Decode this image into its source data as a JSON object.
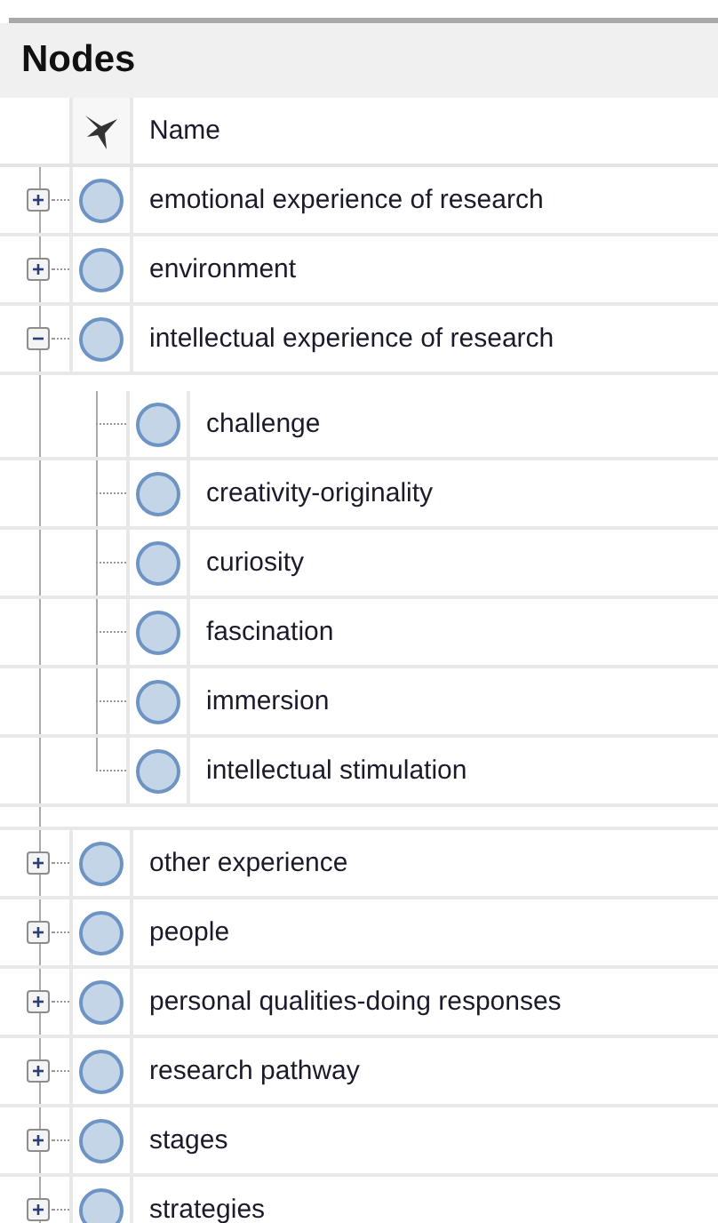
{
  "panel": {
    "title": "Nodes"
  },
  "columns": [
    {
      "label": "Name"
    }
  ],
  "nodes": [
    {
      "name": "emotional experience of research",
      "expanded": false
    },
    {
      "name": "environment",
      "expanded": false
    },
    {
      "name": "intellectual experience of research",
      "expanded": true,
      "children": [
        {
          "name": "challenge"
        },
        {
          "name": "creativity-originality"
        },
        {
          "name": "curiosity"
        },
        {
          "name": "fascination"
        },
        {
          "name": "immersion"
        },
        {
          "name": "intellectual stimulation"
        }
      ]
    },
    {
      "name": "other experience",
      "expanded": false
    },
    {
      "name": "people",
      "expanded": false
    },
    {
      "name": "personal qualities-doing responses",
      "expanded": false
    },
    {
      "name": "research pathway",
      "expanded": false
    },
    {
      "name": "stages",
      "expanded": false
    },
    {
      "name": "strategies",
      "expanded": false
    }
  ]
}
